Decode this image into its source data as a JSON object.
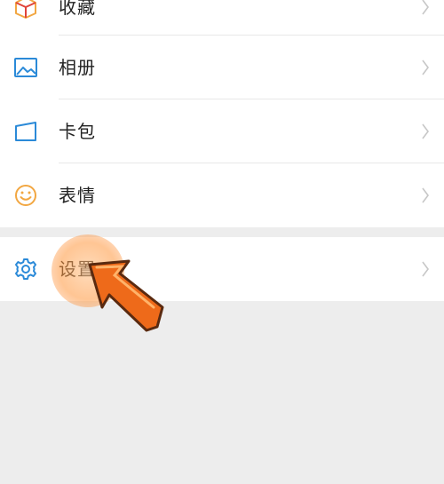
{
  "menu": {
    "items": [
      {
        "label": "收藏",
        "icon": "favorites-cube-icon"
      },
      {
        "label": "相册",
        "icon": "album-icon"
      },
      {
        "label": "卡包",
        "icon": "card-wallet-icon"
      },
      {
        "label": "表情",
        "icon": "smiley-icon"
      }
    ],
    "settings": {
      "label": "设置",
      "icon": "gear-icon"
    }
  },
  "colors": {
    "icon_blue": "#2b8ad8",
    "icon_orange": "#f2a742",
    "chevron": "#c7c7c7",
    "arrow": "#ee6a1a",
    "background": "#ededed"
  }
}
